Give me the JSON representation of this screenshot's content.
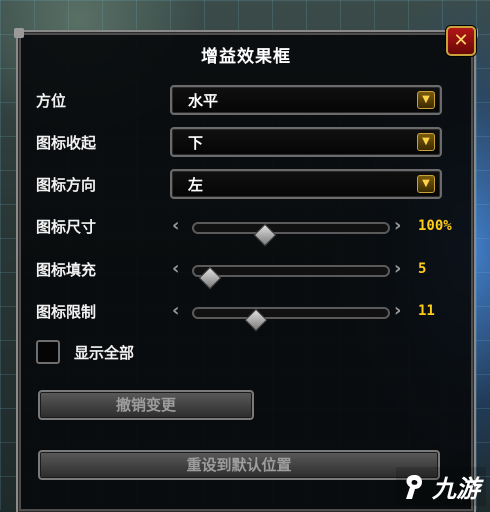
{
  "window": {
    "title": "增益效果框",
    "close_glyph": "✕"
  },
  "rows": {
    "position": {
      "label": "方位",
      "value": "水平"
    },
    "icon_collapse": {
      "label": "图标收起",
      "value": "下"
    },
    "icon_direction": {
      "label": "图标方向",
      "value": "左"
    },
    "icon_size": {
      "label": "图标尺寸",
      "value_text": "100%",
      "fraction": 0.35
    },
    "icon_fill": {
      "label": "图标填充",
      "value_text": "5",
      "fraction": 0.04
    },
    "icon_limit": {
      "label": "图标限制",
      "value_text": "11",
      "fraction": 0.3
    }
  },
  "show_all": {
    "label": "显示全部",
    "checked": false
  },
  "buttons": {
    "undo": "撤销变更",
    "reset": "重设到默认位置"
  },
  "watermark": {
    "text": "九游"
  },
  "icons": {
    "dropdown_arrow": "dropdown-arrow-icon",
    "slider_left": "chevron-left-icon",
    "slider_right": "chevron-right-icon",
    "close": "close-icon",
    "logo": "jiuyou-logo-icon"
  },
  "colors": {
    "value_gold": "#ffcc1a",
    "close_red": "#b21616",
    "frame_border": "#8a8a8a"
  }
}
